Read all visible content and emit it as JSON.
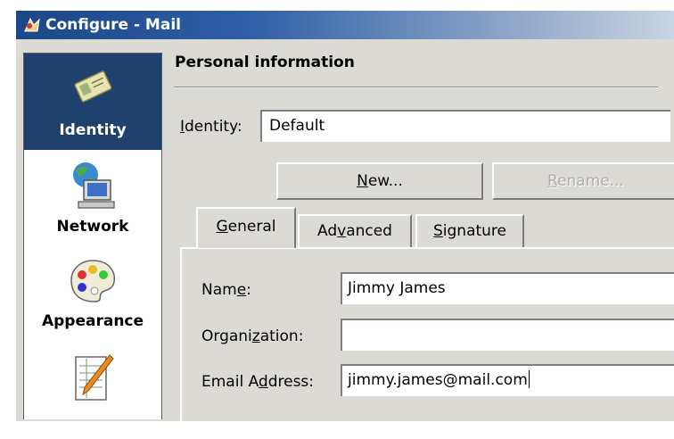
{
  "window": {
    "title": "Configure - Mail"
  },
  "sidebar": {
    "items": [
      {
        "label": "Identity",
        "icon": "id-card-icon",
        "selected": true
      },
      {
        "label": "Network",
        "icon": "network-computer-icon",
        "selected": false
      },
      {
        "label": "Appearance",
        "icon": "palette-icon",
        "selected": false
      },
      {
        "label": "",
        "icon": "notepad-pencil-icon",
        "selected": false
      }
    ]
  },
  "section": {
    "heading": "Personal information"
  },
  "identity": {
    "label_mnemonic": "I",
    "label_rest": "dentity:",
    "value": "Default",
    "new_button": {
      "mnemonic": "N",
      "rest": "ew..."
    },
    "rename_button": {
      "mnemonic": "R",
      "rest": "ename..."
    }
  },
  "tabs": [
    {
      "pre": "",
      "mnemonic": "G",
      "post": "eneral",
      "active": true
    },
    {
      "pre": "Ad",
      "mnemonic": "v",
      "post": "anced",
      "active": false
    },
    {
      "pre": "",
      "mnemonic": "S",
      "post": "ignature",
      "active": false
    }
  ],
  "general": {
    "name": {
      "pre": "Nam",
      "mnemonic": "e",
      "post": ":",
      "value": "Jimmy James"
    },
    "organization": {
      "pre": "Organi",
      "mnemonic": "z",
      "post": "ation:",
      "value": ""
    },
    "email": {
      "pre": "Email A",
      "mnemonic": "d",
      "post": "dress:",
      "value": "jimmy.james@mail.com"
    }
  },
  "colors": {
    "titlebar": "#1c4787",
    "sidebar_selected": "#20406e",
    "window_bg": "#dcdad5"
  }
}
